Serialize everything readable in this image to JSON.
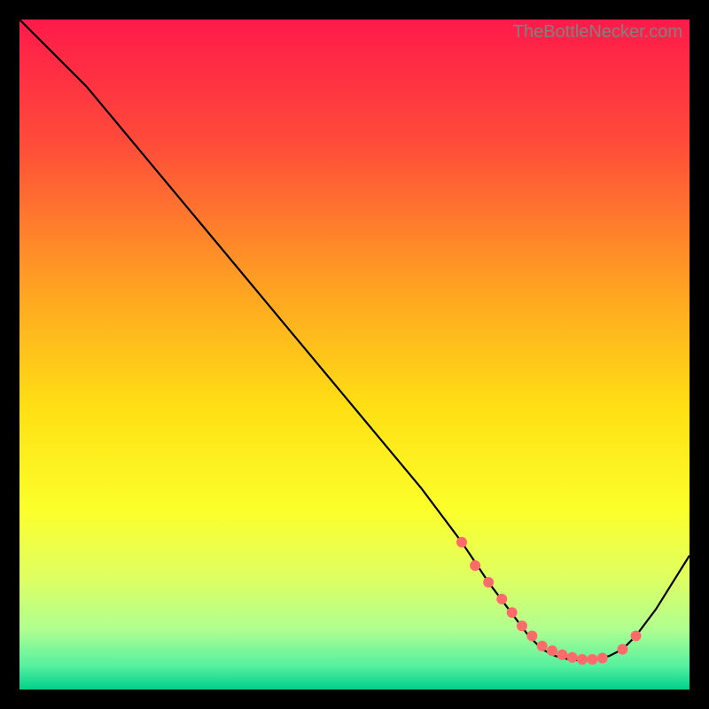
{
  "watermark": "TheBottleNecker.com",
  "chart_data": {
    "type": "line",
    "title": "",
    "xlabel": "",
    "ylabel": "",
    "xlim": [
      0,
      100
    ],
    "ylim": [
      0,
      100
    ],
    "background": {
      "gradient_stops": [
        {
          "offset": 0.0,
          "color": "#ff1a4a"
        },
        {
          "offset": 0.18,
          "color": "#ff4a3a"
        },
        {
          "offset": 0.4,
          "color": "#ffa222"
        },
        {
          "offset": 0.58,
          "color": "#ffe014"
        },
        {
          "offset": 0.73,
          "color": "#fcff2a"
        },
        {
          "offset": 0.83,
          "color": "#e0ff60"
        },
        {
          "offset": 0.91,
          "color": "#b0ff90"
        },
        {
          "offset": 0.965,
          "color": "#55f0a0"
        },
        {
          "offset": 1.0,
          "color": "#00d08a"
        }
      ]
    },
    "series": [
      {
        "name": "bottleneck-curve",
        "color": "#000000",
        "x": [
          0,
          5,
          10,
          20,
          30,
          40,
          50,
          60,
          66,
          70,
          73,
          76,
          78,
          80,
          82,
          84,
          86,
          88,
          90,
          92,
          95,
          100
        ],
        "y": [
          100,
          95,
          90,
          78,
          66,
          54,
          42,
          30,
          22,
          16,
          12,
          8,
          6,
          5,
          4.5,
          4.3,
          4.5,
          5,
          6,
          8,
          12,
          20
        ]
      }
    ],
    "highlight_points": {
      "name": "scatter-dots",
      "color": "#ff6a6a",
      "radius": 6,
      "x": [
        66,
        68,
        70,
        72,
        73.5,
        75,
        76.5,
        78,
        79.5,
        81,
        82.5,
        84,
        85.5,
        87,
        90,
        92
      ],
      "y": [
        22,
        18.5,
        16,
        13.5,
        11.5,
        9.5,
        8,
        6.5,
        5.8,
        5.2,
        4.8,
        4.5,
        4.5,
        4.7,
        6,
        8
      ]
    }
  }
}
